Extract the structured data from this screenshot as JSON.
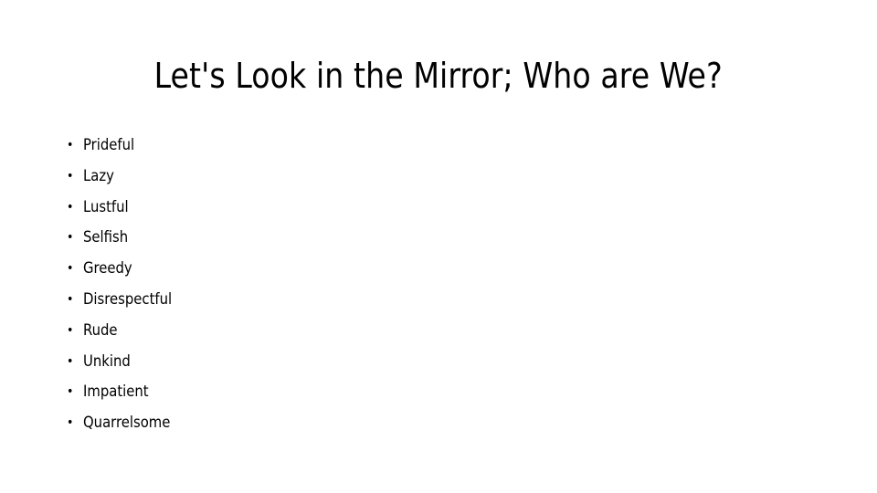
{
  "slide": {
    "title": "Let's Look in the Mirror; Who are We?",
    "background_color": "#FFFFFF",
    "text_color": "#000000",
    "bullet_glyph": "•",
    "bullets": [
      {
        "label": "Prideful"
      },
      {
        "label": "Lazy"
      },
      {
        "label": "Lustful"
      },
      {
        "label": "Selfish"
      },
      {
        "label": "Greedy"
      },
      {
        "label": "Disrespectful"
      },
      {
        "label": "Rude"
      },
      {
        "label": "Unkind"
      },
      {
        "label": "Impatient"
      },
      {
        "label": "Quarrelsome"
      }
    ]
  }
}
